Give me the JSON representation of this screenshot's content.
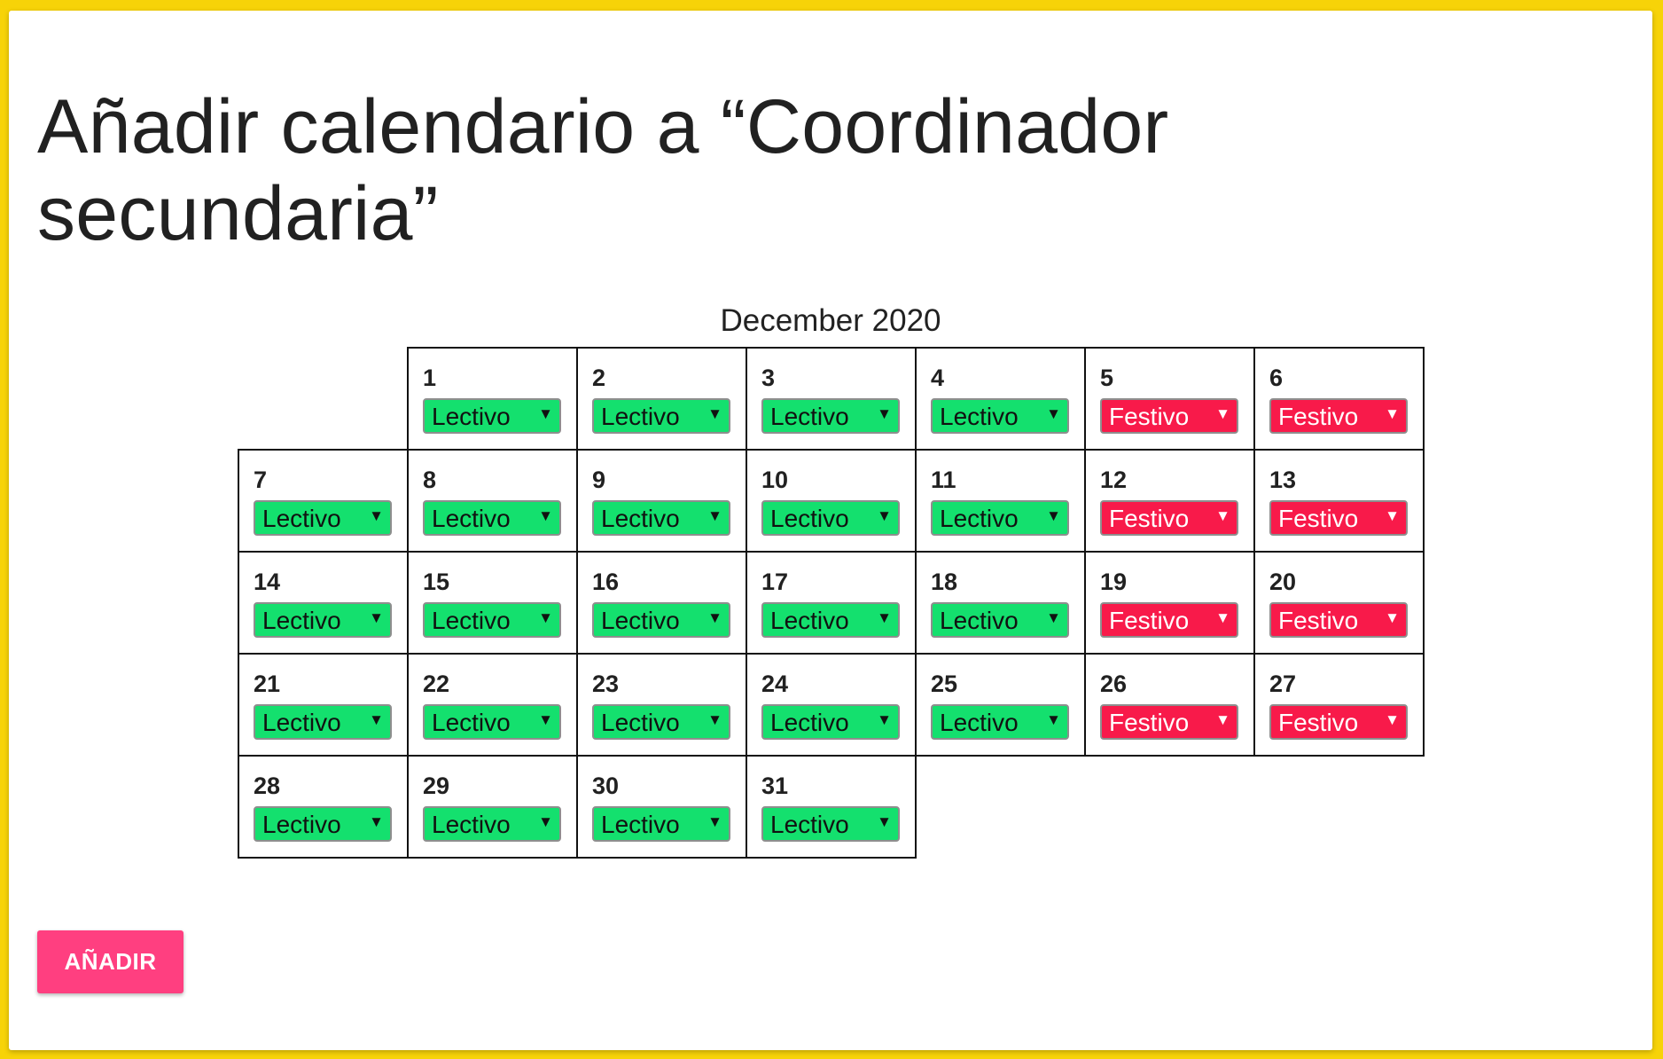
{
  "page": {
    "title": "Añadir calendario a “Coordinador secundaria”",
    "month_label": "December 2020",
    "add_button": "AÑADIR"
  },
  "colors": {
    "background": "#f7d308",
    "lectivo": "#14e06e",
    "festivo": "#f81a4a",
    "button": "#ff3f80"
  },
  "icons": {
    "dropdown": "triangle-down-icon"
  },
  "calendar": {
    "first_weekday_column": 1,
    "days": [
      {
        "day": "1",
        "status": "Lectivo"
      },
      {
        "day": "2",
        "status": "Lectivo"
      },
      {
        "day": "3",
        "status": "Lectivo"
      },
      {
        "day": "4",
        "status": "Lectivo"
      },
      {
        "day": "5",
        "status": "Festivo"
      },
      {
        "day": "6",
        "status": "Festivo"
      },
      {
        "day": "7",
        "status": "Lectivo"
      },
      {
        "day": "8",
        "status": "Lectivo"
      },
      {
        "day": "9",
        "status": "Lectivo"
      },
      {
        "day": "10",
        "status": "Lectivo"
      },
      {
        "day": "11",
        "status": "Lectivo"
      },
      {
        "day": "12",
        "status": "Festivo"
      },
      {
        "day": "13",
        "status": "Festivo"
      },
      {
        "day": "14",
        "status": "Lectivo"
      },
      {
        "day": "15",
        "status": "Lectivo"
      },
      {
        "day": "16",
        "status": "Lectivo"
      },
      {
        "day": "17",
        "status": "Lectivo"
      },
      {
        "day": "18",
        "status": "Lectivo"
      },
      {
        "day": "19",
        "status": "Festivo"
      },
      {
        "day": "20",
        "status": "Festivo"
      },
      {
        "day": "21",
        "status": "Lectivo"
      },
      {
        "day": "22",
        "status": "Lectivo"
      },
      {
        "day": "23",
        "status": "Lectivo"
      },
      {
        "day": "24",
        "status": "Lectivo"
      },
      {
        "day": "25",
        "status": "Lectivo"
      },
      {
        "day": "26",
        "status": "Festivo"
      },
      {
        "day": "27",
        "status": "Festivo"
      },
      {
        "day": "28",
        "status": "Lectivo"
      },
      {
        "day": "29",
        "status": "Lectivo"
      },
      {
        "day": "30",
        "status": "Lectivo"
      },
      {
        "day": "31",
        "status": "Lectivo"
      }
    ]
  }
}
